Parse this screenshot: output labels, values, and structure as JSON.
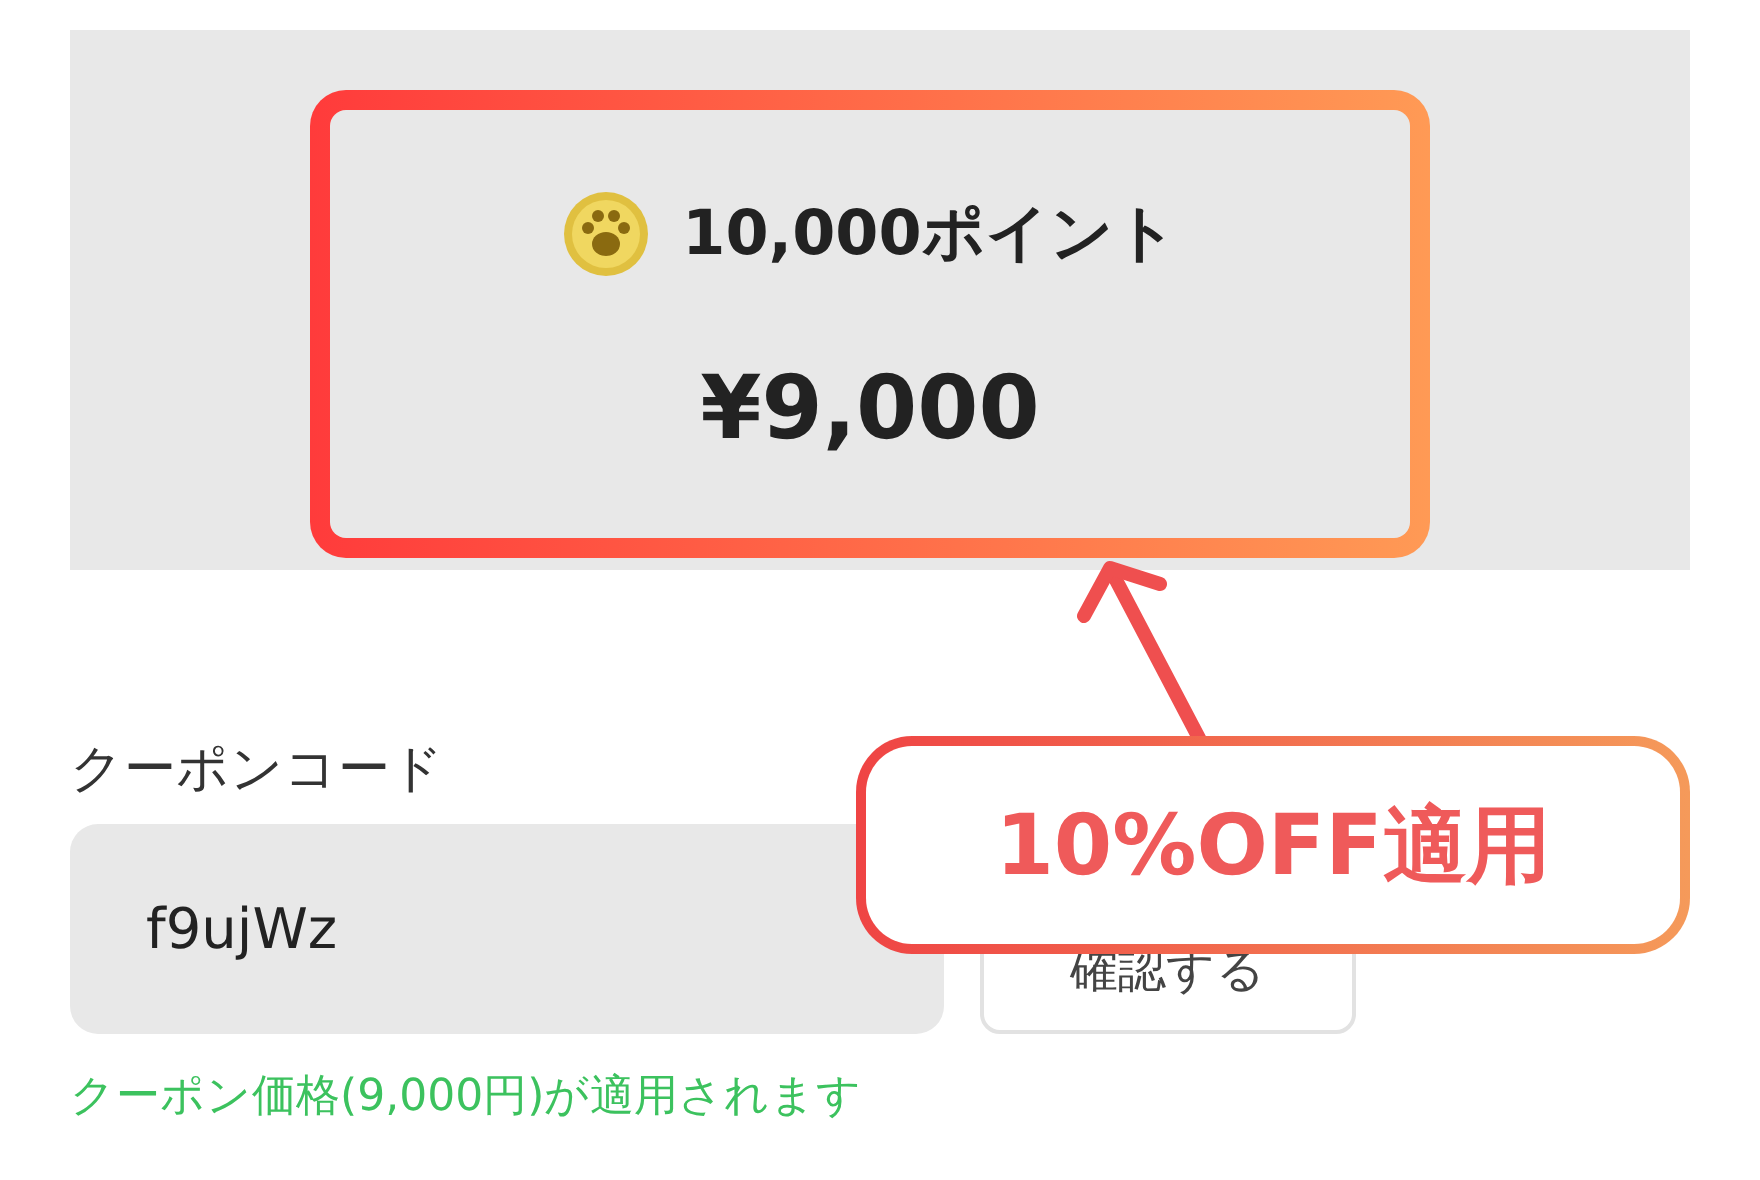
{
  "price_card": {
    "points": "10,000ポイント",
    "price": "¥9,000",
    "highlighted": true
  },
  "coupon": {
    "label": "クーポンコード",
    "value": "f9ujWz",
    "button": "確認する",
    "message": "クーポン価格(9,000円)が適用されます"
  },
  "callout": {
    "text": "10%OFF適用"
  }
}
